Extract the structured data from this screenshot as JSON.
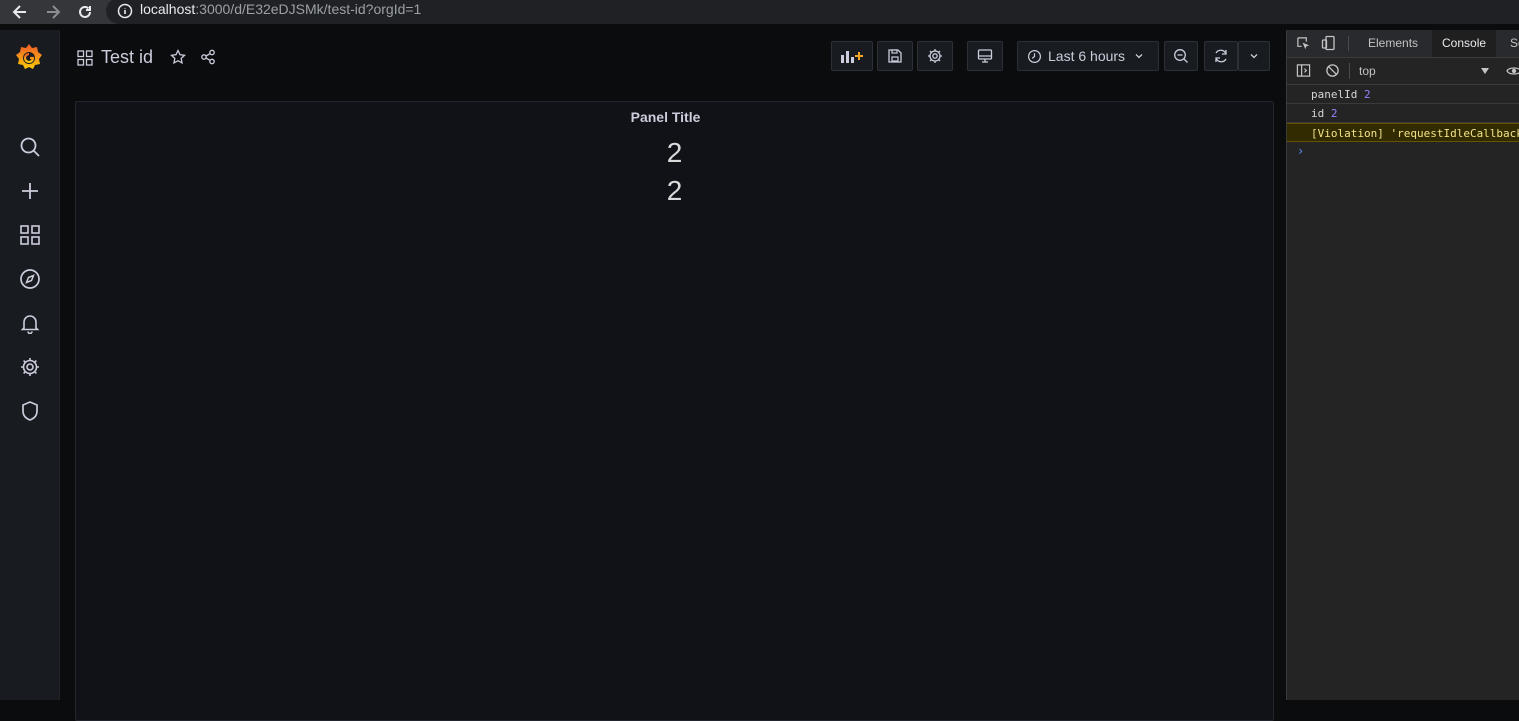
{
  "browser": {
    "url_host": "localhost",
    "url_rest": ":3000/d/E32eDJSMk/test-id?orgId=1"
  },
  "sidebar": {
    "items": [
      "search-icon",
      "plus-icon",
      "dashboards-icon",
      "explore-icon",
      "alerting-icon",
      "config-icon",
      "shield-icon"
    ]
  },
  "dashboard": {
    "title": "Test id",
    "time_range": "Last 6 hours"
  },
  "panel": {
    "title": "Panel Title",
    "values": [
      "2",
      "2"
    ]
  },
  "devtools": {
    "tabs": [
      "Elements",
      "Console",
      "So"
    ],
    "active_tab": "Console",
    "context": "top",
    "logs": [
      {
        "label": "panelId",
        "value": "2"
      },
      {
        "label": "id",
        "value": "2"
      }
    ],
    "warning": "[Violation] 'requestIdleCallback"
  },
  "colors": {
    "background": "#0b0c0e",
    "panel": "#111217",
    "sidebar": "#181b1f",
    "grafana_orange": "#f05a28"
  }
}
